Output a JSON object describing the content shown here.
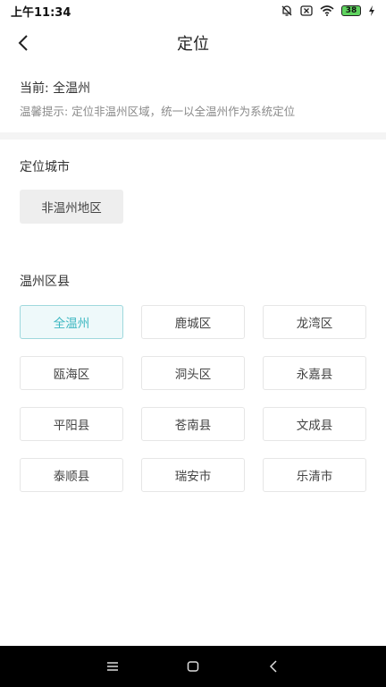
{
  "status_bar": {
    "time": "上午11:34",
    "battery": "38",
    "icons": [
      "bell-off-icon",
      "close-box-icon",
      "wifi-icon",
      "battery-icon",
      "charging-icon"
    ]
  },
  "header": {
    "title": "定位",
    "back_icon": "chevron-left-icon"
  },
  "current": {
    "text": "当前: 全温州"
  },
  "tip": {
    "text": "温馨提示: 定位非温州区域，统一以全温州作为系统定位"
  },
  "location_city": {
    "title": "定位城市",
    "button": "非温州地区"
  },
  "districts": {
    "title": "温州区县",
    "selected": "全温州",
    "items": [
      "全温州",
      "鹿城区",
      "龙湾区",
      "瓯海区",
      "洞头区",
      "永嘉县",
      "平阳县",
      "苍南县",
      "文成县",
      "泰顺县",
      "瑞安市",
      "乐清市"
    ]
  },
  "nav": {
    "icons": [
      "menu-icon",
      "home-icon",
      "back-icon"
    ]
  },
  "colors": {
    "accent": "#3cb7c1",
    "accent_bg": "#eef9fa"
  }
}
